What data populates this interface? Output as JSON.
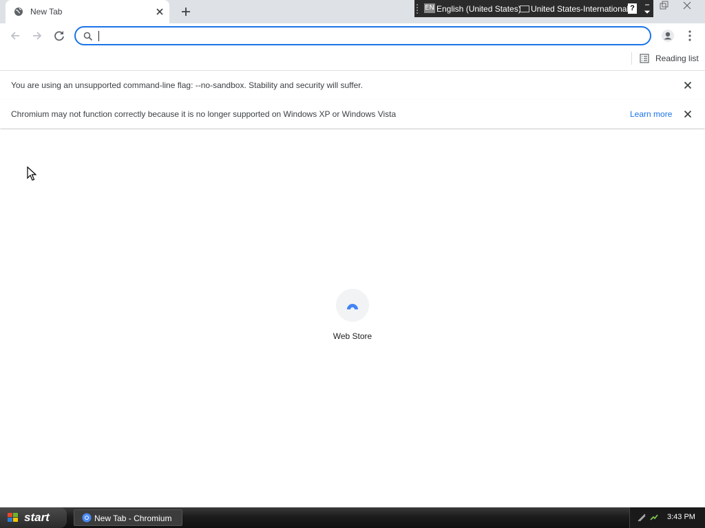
{
  "tab": {
    "title": "New Tab",
    "icon": "globe-icon"
  },
  "language_bar": {
    "language_code": "EN",
    "language": "English (United States)",
    "keyboard": "United States-International",
    "help": "?"
  },
  "omnibox": {
    "value": "",
    "placeholder": ""
  },
  "bookmarks_bar": {
    "reading_list": "Reading list"
  },
  "infobars": [
    {
      "text": "You are using an unsupported command-line flag: --no-sandbox. Stability and security will suffer."
    },
    {
      "text": "Chromium may not function correctly because it is no longer supported on Windows XP or Windows Vista",
      "link": "Learn more"
    }
  ],
  "shortcuts": [
    {
      "label": "Web Store",
      "icon": "web-store-icon"
    }
  ],
  "taskbar": {
    "start": "start",
    "window": "New Tab - Chromium",
    "clock": "3:43 PM"
  },
  "colors": {
    "accent": "#1a73e8",
    "tabstrip": "#dee1e6",
    "taskbar": "#1c1c1c"
  }
}
